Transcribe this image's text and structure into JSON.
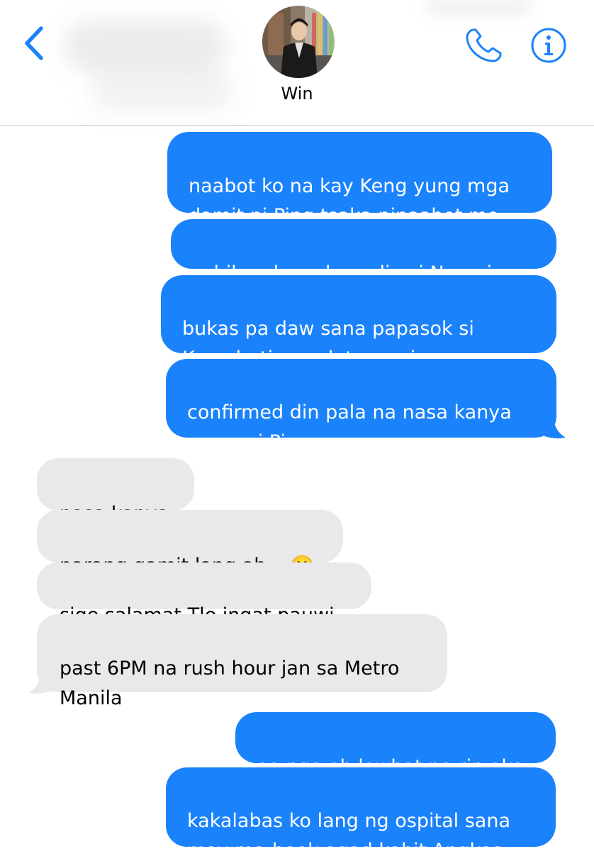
{
  "header": {
    "contact_name": "Win",
    "accent_color": "#1a82fb"
  },
  "icons": {
    "back": "chevron-left-icon",
    "call": "phone-icon",
    "info": "info-icon"
  },
  "messages": [
    {
      "direction": "sent",
      "text": "naabot ko na kay Keng yung mga\ndamit ni Ping tsaka pinaabot mo"
    },
    {
      "direction": "sent",
      "text": "sabihan ko nalang din si Namping"
    },
    {
      "direction": "sent",
      "text": "bukas pa daw sana papasok si\nKeng buti nag duty na siya ngayon"
    },
    {
      "direction": "sent",
      "text": "confirmed din pala na nasa kanya\nmuna si Ping"
    },
    {
      "direction": "received",
      "text": "nasa kanya"
    },
    {
      "direction": "received",
      "text": "parang gamit lang ah... 🙂"
    },
    {
      "direction": "received",
      "text": "sige salamat Tle ingat pauwi"
    },
    {
      "direction": "received",
      "text": "past 6PM na rush hour jan sa Metro\nManila"
    },
    {
      "direction": "sent",
      "text": "oo nga eh lowbat na rin ako"
    },
    {
      "direction": "sent",
      "text": "kakalabas ko lang ng ospital sana\nmay ma-book agad kahit Angkas"
    }
  ]
}
